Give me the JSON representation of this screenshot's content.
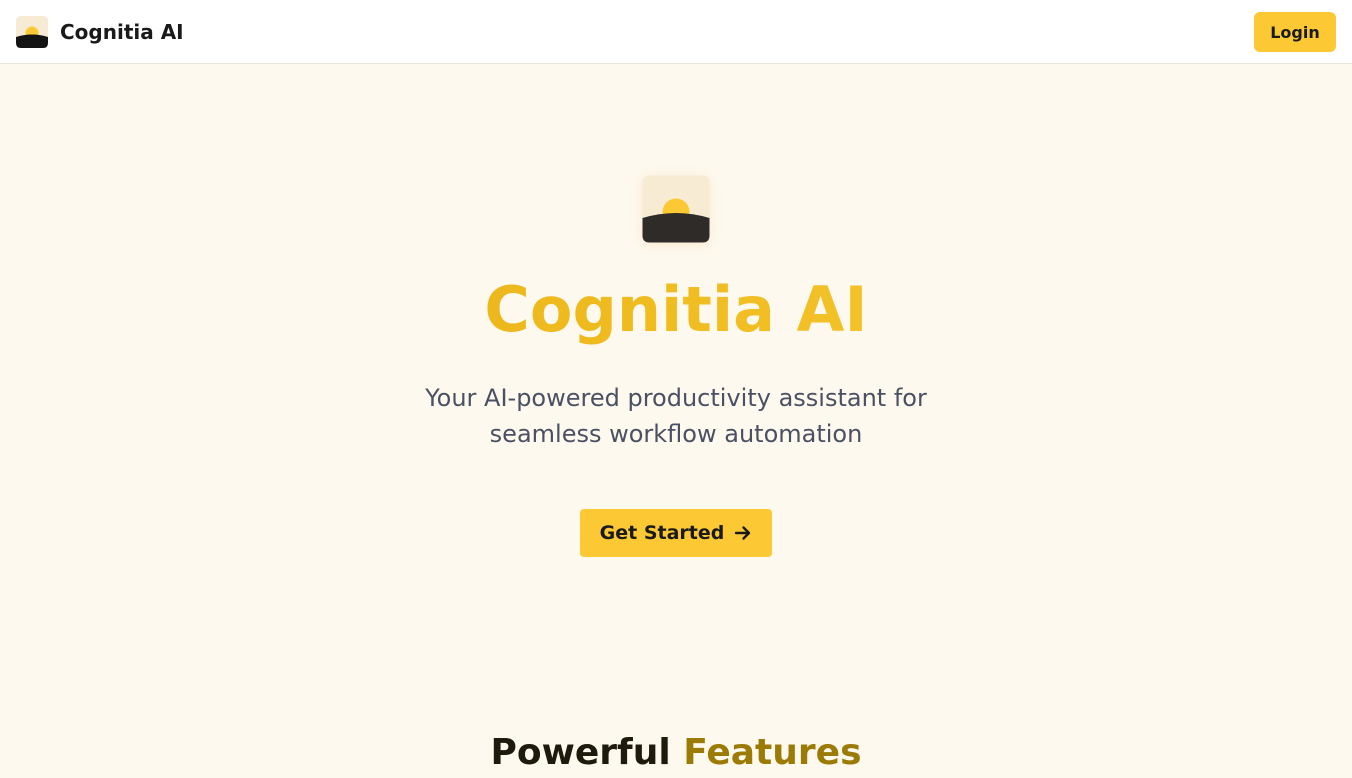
{
  "header": {
    "brand_name": "Cognitia AI",
    "login_label": "Login"
  },
  "hero": {
    "title": "Cognitia AI",
    "subtitle": "Your AI-powered productivity assistant for seamless workflow automation",
    "cta_label": "Get Started"
  },
  "features": {
    "heading_part1": "Powerful",
    "heading_part2": "Features"
  },
  "icons": {
    "logo": "sunrise-logo-icon",
    "cta_arrow": "arrow-right-icon"
  },
  "colors": {
    "accent": "#fcc934",
    "background": "#fdf9ee",
    "title_gold": "#e9b41a",
    "text_dark": "#1a1a1a",
    "text_muted": "#4b5063",
    "logo_dark": "#2e2b28",
    "logo_sun": "#fcc934",
    "logo_bg": "#f8ebd4"
  }
}
